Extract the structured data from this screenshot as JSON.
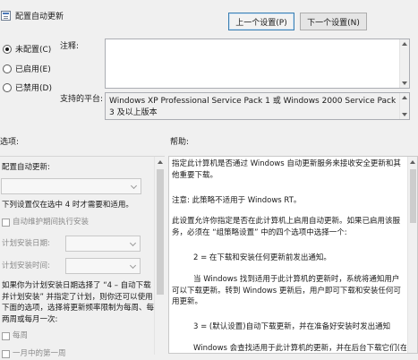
{
  "window": {
    "title": "配置自动更新",
    "prev_button": "上一个设置(P)",
    "next_button": "下一个设置(N)"
  },
  "state": {
    "options": [
      {
        "label": "未配置(C)",
        "selected": true
      },
      {
        "label": "已启用(E)",
        "selected": false
      },
      {
        "label": "已禁用(D)",
        "selected": false
      }
    ],
    "comment_label": "注释:",
    "comment_value": "",
    "supported_label": "支持的平台:",
    "supported_value": "Windows XP Professional Service Pack 1 或 Windows 2000 Service Pack 3 及以上版本"
  },
  "options_panel": {
    "header": "选项:",
    "configure_label": "配置自动更新:",
    "configure_value": "",
    "note": "下列设置仅在选中 4 时才需要和适用。",
    "maintenance_checkbox": "自动维护期间执行安装",
    "schedule_day_label": "计划安装日期:",
    "schedule_day_value": "",
    "schedule_time_label": "计划安装时间:",
    "schedule_time_value": "",
    "hint": "如果你为计划安装日期选择了 “4 – 自动下载并计划安装” 并指定了计划，则你还可以使用下面的选项，选择将更新频率限制为每周、每两周或每月一次:",
    "weekly_checkbox": "每周",
    "first_week_checkbox": "一月中的第一周"
  },
  "help_panel": {
    "header": "帮助:",
    "paragraphs": [
      "指定此计算机是否通过 Windows 自动更新服务来接收安全更新和其他重要下载。",
      "注意: 此策略不适用于 Windows RT。",
      "此设置允许你指定是否在此计算机上启用自动更新。如果已启用该服务，必须在 “组策略设置” 中的四个选项中选择一个:",
      "2 = 在下载和安装任何更新前发出通知。",
      "当 Windows 找到适用于此计算机的更新时，系统将通知用户可以下载更新。转到 Windows 更新后，用户即可下载和安装任何可用更新。",
      "3 = (默认设置)自动下载更新，并在准备好安装时发出通知",
      "Windows 会查找适用于此计算机的更新，并在后台下载它们(在此"
    ]
  }
}
